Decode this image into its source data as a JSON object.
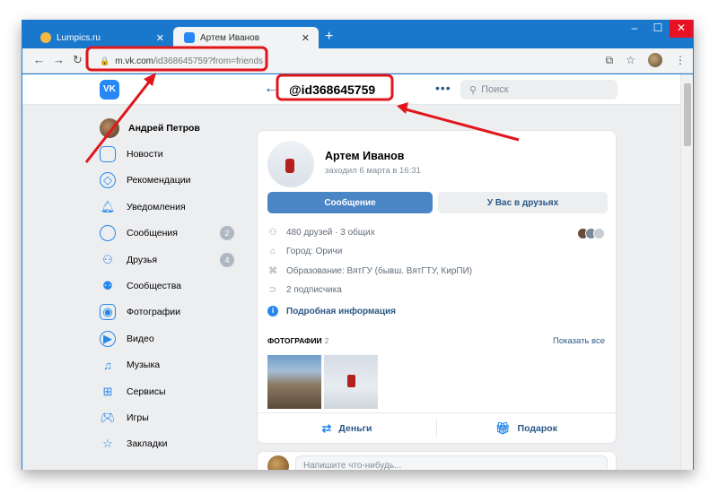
{
  "browser": {
    "tabs": [
      {
        "title": "Lumpics.ru",
        "active": false,
        "favicon_color": "#f4b942"
      },
      {
        "title": "Артем Иванов",
        "active": true,
        "favicon_color": "#2787f5"
      }
    ],
    "new_tab": "+",
    "url_domain": "m.vk.com",
    "url_path": "/id368645759?from=friends"
  },
  "header": {
    "logo": "VK",
    "screen_name": "@id368645759",
    "more": "•••",
    "search_placeholder": "Поиск"
  },
  "sidebar": {
    "user_name": "Андрей Петров",
    "items": [
      {
        "label": "Новости",
        "icon": "news-icon"
      },
      {
        "label": "Рекомендации",
        "icon": "compass-icon"
      },
      {
        "label": "Уведомления",
        "icon": "bell-icon"
      },
      {
        "label": "Сообщения",
        "icon": "message-icon",
        "badge": "2"
      },
      {
        "label": "Друзья",
        "icon": "friends-icon",
        "badge": "4"
      },
      {
        "label": "Сообщества",
        "icon": "communities-icon"
      },
      {
        "label": "Фотографии",
        "icon": "camera-icon"
      },
      {
        "label": "Видео",
        "icon": "video-icon"
      },
      {
        "label": "Музыка",
        "icon": "music-icon"
      },
      {
        "label": "Сервисы",
        "icon": "services-icon"
      },
      {
        "label": "Игры",
        "icon": "gamepad-icon"
      },
      {
        "label": "Закладки",
        "icon": "star-icon"
      }
    ]
  },
  "profile": {
    "name": "Артем Иванов",
    "status": "заходил 6 марта в 16:31",
    "message_button": "Сообщение",
    "friends_button": "У Вас в друзьях",
    "info": {
      "friends": "480 друзей · 3 общих",
      "city": "Город: Оричи",
      "education": "Образование: ВятГУ (бывш. ВятГТУ, КирПИ)",
      "followers": "2 подписчика",
      "details_link": "Подробная информация"
    },
    "photos_title": "ФОТОГРАФИИ",
    "photos_count": "2",
    "show_all": "Показать все",
    "money_label": "Деньги",
    "gift_label": "Подарок"
  },
  "post_box": {
    "placeholder": "Напишите что-нибудь..."
  },
  "colors": {
    "accent": "#2787f5",
    "annotation": "#e0161b",
    "window_frame": "#1d7fd6"
  }
}
